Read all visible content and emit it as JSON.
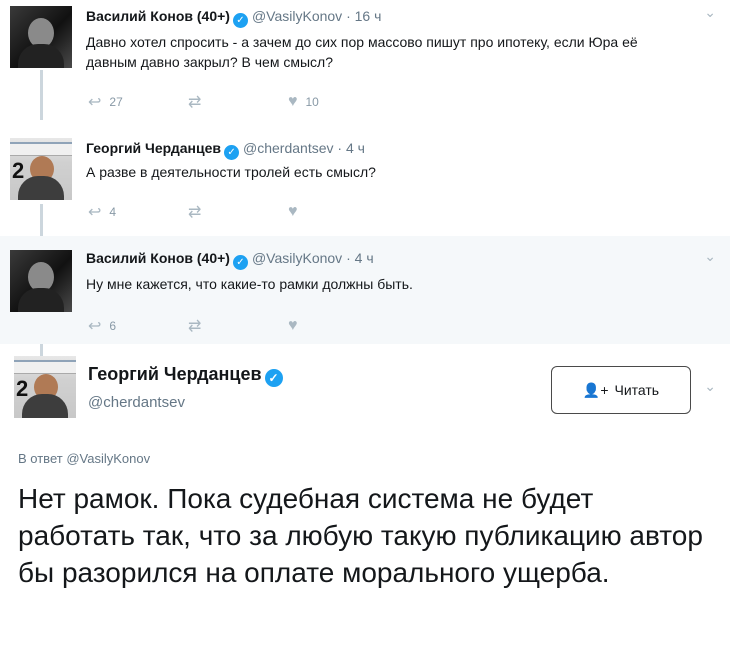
{
  "thread": [
    {
      "name": "Василий Конов (40+)",
      "handle": "@VasilyKonov",
      "dot": "·",
      "time": "16 ч",
      "text": "Давно хотел спросить - а зачем до сих пор массово пишут про ипотеку, если Юра её давным давно закрыл? В чем смысл?",
      "reply_count": "27",
      "retweet_count": "",
      "like_count": "10",
      "avatar": "dark"
    },
    {
      "name": "Георгий Черданцев",
      "handle": "@cherdantsev",
      "dot": "·",
      "time": "4 ч",
      "text": "А разве в деятельности тролей есть смысл?",
      "reply_count": "4",
      "retweet_count": "",
      "like_count": "",
      "avatar": "light"
    },
    {
      "name": "Василий Конов (40+)",
      "handle": "@VasilyKonov",
      "dot": "·",
      "time": "4 ч",
      "text": "Ну мне кажется, что какие-то рамки должны быть.",
      "reply_count": "6",
      "retweet_count": "",
      "like_count": "",
      "avatar": "dark"
    }
  ],
  "main_tweet": {
    "name": "Георгий Черданцев",
    "handle": "@cherdantsev",
    "follow_label": "Читать",
    "reply_to_prefix": "В ответ",
    "reply_to_handle": "@VasilyKonov",
    "text": "Нет рамок. Пока судебная система не будет работать так, что за любую такую публикацию автор бы разорился на оплате морального ущерба."
  },
  "icons": {
    "verified": "verified-badge-icon",
    "reply": "reply-icon",
    "retweet": "retweet-icon",
    "like": "heart-icon",
    "more": "chevron-down-icon",
    "follow": "add-user-icon"
  },
  "colors": {
    "verified": "#1da1f2",
    "secondary_text": "#657786",
    "thread_line": "#ccd6dd",
    "shaded_bg": "#f5f8fa"
  }
}
